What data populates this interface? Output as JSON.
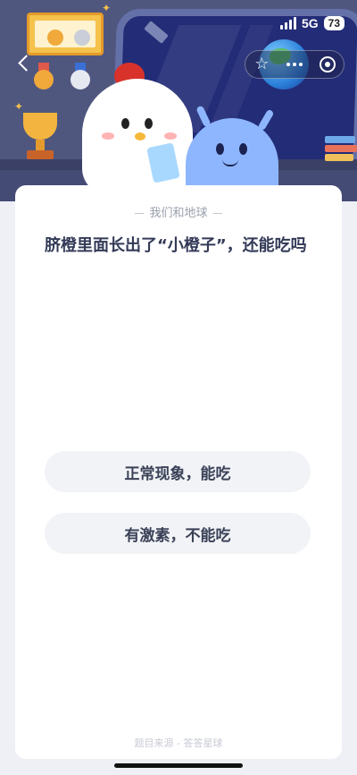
{
  "status_bar": {
    "network": "5G",
    "battery": "73"
  },
  "header": {
    "icons": [
      "back-icon",
      "star-icon",
      "more-icon",
      "target-icon"
    ]
  },
  "quiz": {
    "category": "我们和地球",
    "question": "脐橙里面长出了“小橙子”，还能吃吗",
    "options": [
      "正常现象，能吃",
      "有激素，不能吃"
    ],
    "source": "题目来源 - 答答星球"
  },
  "colors": {
    "hero_bg": "#50577f",
    "card_bg": "#ffffff",
    "option_bg": "#f1f3f6",
    "question_text": "#333a57"
  }
}
